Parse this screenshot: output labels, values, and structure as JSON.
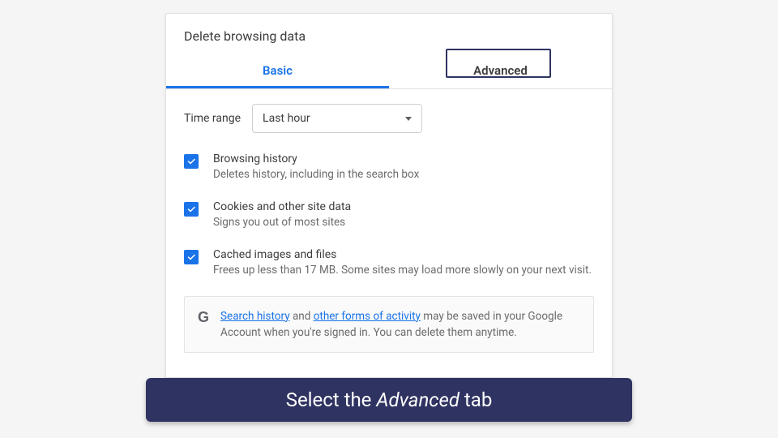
{
  "dialog": {
    "title": "Delete browsing data",
    "tabs": {
      "basic": "Basic",
      "advanced": "Advanced"
    },
    "timerange": {
      "label": "Time range",
      "value": "Last hour"
    },
    "options": [
      {
        "title": "Browsing history",
        "desc": "Deletes history, including in the search box",
        "checked": true
      },
      {
        "title": "Cookies and other site data",
        "desc": "Signs you out of most sites",
        "checked": true
      },
      {
        "title": "Cached images and files",
        "desc": "Frees up less than 17 MB. Some sites may load more slowly on your next visit.",
        "checked": true
      }
    ],
    "info": {
      "link1": "Search history",
      "mid1": " and ",
      "link2": "other forms of activity",
      "rest": " may be saved in your Google Account when you're signed in. You can delete them anytime."
    }
  },
  "caption": {
    "pre": "Select the ",
    "em": "Advanced",
    "post": " tab"
  }
}
